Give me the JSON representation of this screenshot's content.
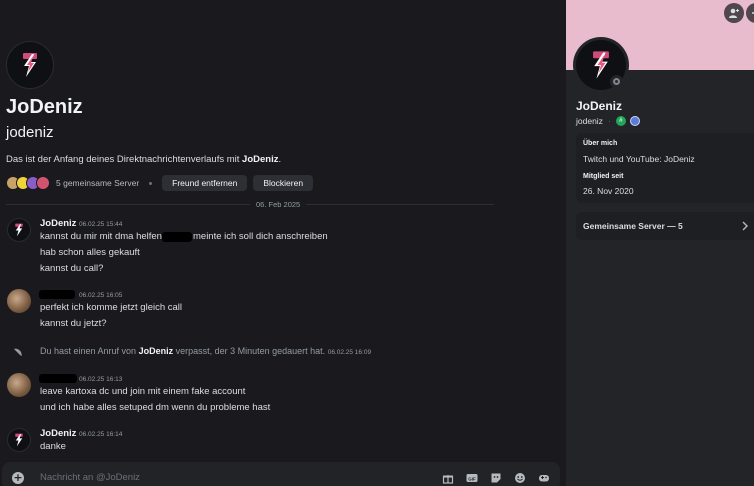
{
  "intro": {
    "display_name": "JoDeniz",
    "username": "jodeniz",
    "description_prefix": "Das ist der Anfang deines Direktnachrichtenverlaufs mit ",
    "description_name": "JoDeniz",
    "description_suffix": ".",
    "mutual_servers": "5 gemeinsame Server",
    "remove_friend": "Freund entfernen",
    "block": "Blockieren"
  },
  "date_divider": "06. Feb 2025",
  "messages": [
    {
      "author": "JoDeniz",
      "time": "06.02.25 15:44",
      "lines": [
        "kannst du mir mit dma helfen",
        "meinte ich soll dich anschreiben",
        "hab schon alles gekauft",
        "kannst du call?"
      ]
    },
    {
      "author": "",
      "time": "06.02.25 16:05",
      "lines": [
        "perfekt ich komme jetzt gleich call",
        "kannst du jetzt?"
      ]
    },
    {
      "author": "",
      "time": "06.02.25 16:13",
      "lines": [
        "leave kartoxa dc und join mit einem fake account",
        "und ich habe alles setuped dm wenn du probleme hast"
      ]
    },
    {
      "author": "JoDeniz",
      "time": "06.02.25 16:14",
      "lines": [
        "danke"
      ]
    }
  ],
  "missed_call": {
    "prefix": "Du hast einen Anruf von ",
    "name": "JoDeniz",
    "suffix": " verpasst, der 3 Minuten gedauert hat.",
    "time": "06.02.25 16:09"
  },
  "composer": {
    "placeholder": "Nachricht an @JoDeniz",
    "icons": [
      "gift-icon",
      "gif-icon",
      "sticker-icon",
      "emoji-icon",
      "apps-icon"
    ]
  },
  "profile": {
    "display_name": "JoDeniz",
    "username": "jodeniz",
    "about_label": "Über mich",
    "about_text": "Twitch und YouTube: JoDeniz",
    "member_since_label": "Mitglied seit",
    "member_since": "26. Nov 2020",
    "mutual_servers": "Gemeinsame Server — 5",
    "status": "offline"
  },
  "colors": {
    "banner": "#e8bccd",
    "accent": "#f2f3f5",
    "background": "#1a1a1e",
    "panel": "#232428"
  }
}
